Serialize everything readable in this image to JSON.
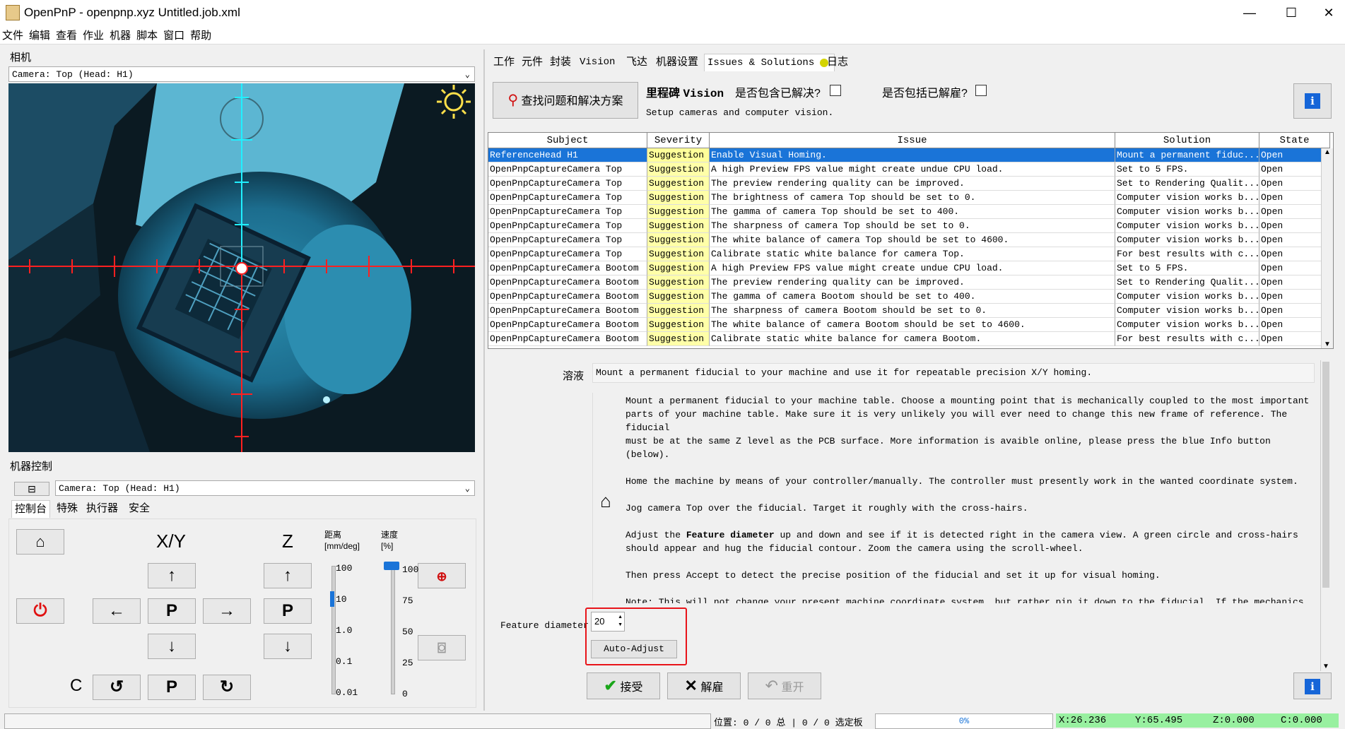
{
  "window": {
    "title": "OpenPnP - openpnp.xyz Untitled.job.xml",
    "minimize": "—",
    "maximize": "☐",
    "close": "✕"
  },
  "menu": [
    "文件",
    "编辑",
    "查看",
    "作业",
    "机器",
    "脚本",
    "窗口",
    "帮助"
  ],
  "camera_panel": {
    "label": "相机",
    "selector": "Camera: Top (Head: H1)"
  },
  "machine_controls": {
    "label": "机器控制",
    "collapse": "⊟",
    "selector": "Camera: Top (Head: H1)",
    "tabs": [
      "控制台",
      "特殊",
      "执行器",
      "安全"
    ],
    "xy_label": "X/Y",
    "z_label": "Z",
    "c_label": "C",
    "park": "P",
    "distance_label": "距离",
    "distance_unit": "[mm/deg]",
    "speed_label": "速度",
    "speed_unit": "[%]",
    "distance_ticks": [
      "100",
      "10",
      "1.0",
      "0.1",
      "0.01"
    ],
    "speed_ticks": [
      "100",
      "75",
      "50",
      "25",
      "0"
    ],
    "distance_selected": "10",
    "speed_value": 100
  },
  "tabs": [
    "工作",
    "元件",
    "封装",
    "Vision",
    "飞达",
    "机器设置",
    "Issues & Solutions",
    "日志"
  ],
  "issues": {
    "find_button": "查找问题和解决方案",
    "milestone_prefix": "里程碑",
    "milestone_name": "Vision",
    "milestone_desc": "Setup cameras and computer vision.",
    "include_solved": "是否包含已解决?",
    "include_dismissed": "是否包括已解雇?",
    "columns": [
      "Subject",
      "Severity",
      "Issue",
      "Solution",
      "State"
    ],
    "rows": [
      [
        "ReferenceHead H1",
        "Suggestion",
        "Enable Visual Homing.",
        "Mount a permanent fiduc...",
        "Open"
      ],
      [
        "OpenPnpCaptureCamera Top",
        "Suggestion",
        "A high Preview FPS value might create undue CPU load.",
        "Set to 5 FPS.",
        "Open"
      ],
      [
        "OpenPnpCaptureCamera Top",
        "Suggestion",
        "The preview rendering quality can be improved.",
        "Set to Rendering Qualit...",
        "Open"
      ],
      [
        "OpenPnpCaptureCamera Top",
        "Suggestion",
        "The brightness of camera Top should be set to 0.",
        "Computer vision works b...",
        "Open"
      ],
      [
        "OpenPnpCaptureCamera Top",
        "Suggestion",
        "The gamma of camera Top should be set to 400.",
        "Computer vision works b...",
        "Open"
      ],
      [
        "OpenPnpCaptureCamera Top",
        "Suggestion",
        "The sharpness of camera Top should be set to 0.",
        "Computer vision works b...",
        "Open"
      ],
      [
        "OpenPnpCaptureCamera Top",
        "Suggestion",
        "The white balance of camera Top should be set to 4600.",
        "Computer vision works b...",
        "Open"
      ],
      [
        "OpenPnpCaptureCamera Top",
        "Suggestion",
        "Calibrate static white balance for camera Top.",
        "For best results with c...",
        "Open"
      ],
      [
        "OpenPnpCaptureCamera Bootom",
        "Suggestion",
        "A high Preview FPS value might create undue CPU load.",
        "Set to 5 FPS.",
        "Open"
      ],
      [
        "OpenPnpCaptureCamera Bootom",
        "Suggestion",
        "The preview rendering quality can be improved.",
        "Set to Rendering Qualit...",
        "Open"
      ],
      [
        "OpenPnpCaptureCamera Bootom",
        "Suggestion",
        "The gamma of camera Bootom should be set to 400.",
        "Computer vision works b...",
        "Open"
      ],
      [
        "OpenPnpCaptureCamera Bootom",
        "Suggestion",
        "The sharpness of camera Bootom should be set to 0.",
        "Computer vision works b...",
        "Open"
      ],
      [
        "OpenPnpCaptureCamera Bootom",
        "Suggestion",
        "The white balance of camera Bootom should be set to 4600.",
        "Computer vision works b...",
        "Open"
      ],
      [
        "OpenPnpCaptureCamera Bootom",
        "Suggestion",
        "Calibrate static white balance for camera Bootom.",
        "For best results with c...",
        "Open"
      ]
    ]
  },
  "detail": {
    "solution_label": "溶液",
    "solution_text": "Mount a permanent fiducial to your machine and use it for repeatable precision X/Y homing.",
    "instructions": "Mount a permanent fiducial to your machine table. Choose a mounting point that is mechanically coupled to the most important\nparts of your machine table. Make sure it is very unlikely you will ever need to change this new frame of reference. The fiducial\nmust be at the same Z level as the PCB surface. More information is avaible online, please press the blue Info button (below).\n\nHome the machine by means of your controller/manually. The controller must presently work in the wanted coordinate system.\n\nJog camera Top over the fiducial. Target it roughly with the cross-hairs.",
    "instructions_adjust_pre": "Adjust the ",
    "instructions_adjust_bold": "Feature diameter",
    "instructions_adjust_post": " up and down and see if it is detected right in the camera view. A green circle and cross-hairs\nshould appear and hug the fiducial contour. Zoom the camera using the scroll-wheel.",
    "instructions_tail": "Then press Accept to detect the precise position of the fiducial and set it up for visual homing.\n\nNote: This will not change your present machine coordinate system, but rather pin it down to the fiducial. If the mechanics were\nto change slightly in the future (e.g. a homing end-switch slightly moved), the homing fiducial will still be able to precisely\npreserve the frame of reference in X and Y.",
    "feature_label": "Feature diameter",
    "feature_value": "20",
    "auto_adjust": "Auto-Adjust",
    "accept": "接受",
    "dismiss": "解雇",
    "reopen": "重开"
  },
  "status": {
    "position": "位置: 0 / 0 总 | 0 / 0 选定板",
    "progress": "0%",
    "progress_value": 0,
    "x": "X:26.236",
    "y": "Y:65.495",
    "z": "Z:0.000",
    "c": "C:0.000"
  },
  "colors": {
    "selection": "#1a74d8",
    "severity_bg": "#ffffa8",
    "highlight_box": "#e8141a",
    "coord_bg": "#98f0a0",
    "info_blue": "#1565d8",
    "crosshair_red": "#ff2020",
    "crosshair_cyan": "#20f0ff"
  }
}
